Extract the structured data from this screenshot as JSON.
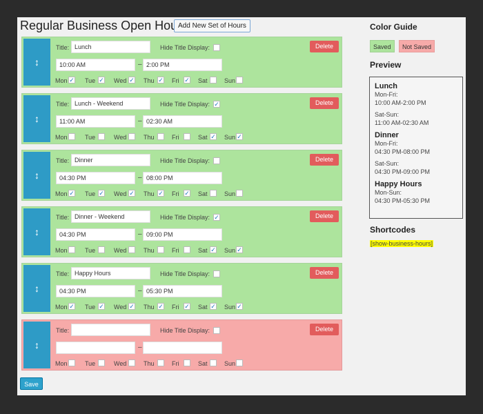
{
  "page": {
    "title": "Regular Business Open Hours",
    "add_button": "Add New Set of Hours",
    "save_button": "Save"
  },
  "labels": {
    "title": "Title:",
    "hide_title": "Hide Title Display:",
    "delete": "Delete",
    "dash": "–"
  },
  "days": [
    "Mon",
    "Tue",
    "Wed",
    "Thu",
    "Fri",
    "Sat",
    "Sun"
  ],
  "blocks": [
    {
      "title": "Lunch",
      "hide": false,
      "start": "10:00 AM",
      "end": "2:00 PM",
      "checked": [
        true,
        true,
        true,
        true,
        true,
        false,
        false
      ],
      "status": "saved"
    },
    {
      "title": "Lunch - Weekend",
      "hide": true,
      "start": "11:00 AM",
      "end": "02:30 AM",
      "checked": [
        false,
        false,
        false,
        false,
        false,
        true,
        true
      ],
      "status": "saved"
    },
    {
      "title": "Dinner",
      "hide": false,
      "start": "04:30 PM",
      "end": "08:00 PM",
      "checked": [
        true,
        true,
        true,
        true,
        true,
        false,
        false
      ],
      "status": "saved"
    },
    {
      "title": "Dinner - Weekend",
      "hide": true,
      "start": "04:30 PM",
      "end": "09:00 PM",
      "checked": [
        false,
        false,
        false,
        false,
        false,
        true,
        true
      ],
      "status": "saved"
    },
    {
      "title": "Happy Hours",
      "hide": false,
      "start": "04:30 PM",
      "end": "05:30 PM",
      "checked": [
        true,
        true,
        true,
        true,
        true,
        true,
        true
      ],
      "status": "saved"
    },
    {
      "title": "",
      "hide": false,
      "start": "",
      "end": "",
      "checked": [
        false,
        false,
        false,
        false,
        false,
        false,
        false
      ],
      "status": "notsaved"
    }
  ],
  "sidebar": {
    "color_guide": "Color Guide",
    "saved": "Saved",
    "not_saved": "Not Saved",
    "preview_heading": "Preview",
    "preview": [
      {
        "name": "Lunch",
        "lines": [
          "Mon-Fri:",
          "10:00 AM-2:00 PM",
          "",
          "Sat-Sun:",
          "11:00 AM-02:30 AM"
        ]
      },
      {
        "name": "Dinner",
        "lines": [
          "Mon-Fri:",
          "04:30 PM-08:00 PM",
          "",
          "Sat-Sun:",
          "04:30 PM-09:00 PM"
        ]
      },
      {
        "name": "Happy Hours",
        "lines": [
          "Mon-Sun:",
          "04:30 PM-05:30 PM"
        ]
      }
    ],
    "shortcodes_heading": "Shortcodes",
    "shortcode": "[show-business-hours]"
  },
  "colors": {
    "saved_bg": "#ade49d",
    "not_saved_bg": "#f7aaa9",
    "handle": "#2e9bc6",
    "delete": "#e25c5c"
  },
  "icons": {
    "handle": "drag-handle-icon",
    "checkbox": "checkbox-icon"
  }
}
